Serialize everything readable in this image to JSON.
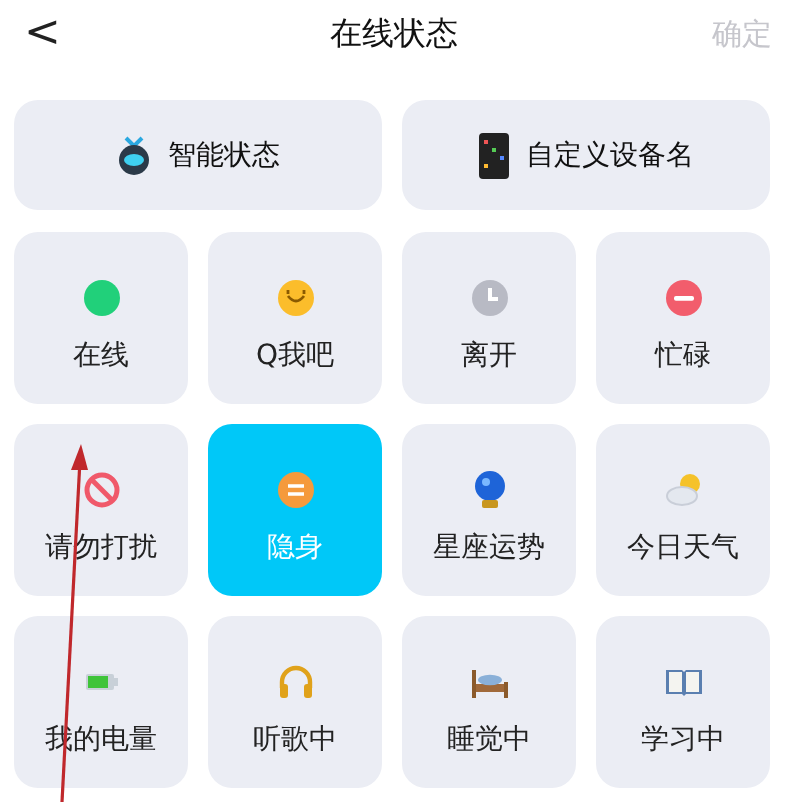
{
  "header": {
    "back": "<",
    "title": "在线状态",
    "confirm": "确定",
    "confirm_disabled": true
  },
  "quick_actions": [
    {
      "label": "智能状态"
    },
    {
      "label": "自定义设备名"
    }
  ],
  "statuses": [
    {
      "label": "在线",
      "selected": false
    },
    {
      "label": "Q我吧",
      "selected": false
    },
    {
      "label": "离开",
      "selected": false
    },
    {
      "label": "忙碌",
      "selected": false
    },
    {
      "label": "请勿打扰",
      "selected": false
    },
    {
      "label": "隐身",
      "selected": true
    },
    {
      "label": "星座运势",
      "selected": false
    },
    {
      "label": "今日天气",
      "selected": false
    },
    {
      "label": "我的电量",
      "selected": false
    },
    {
      "label": "听歌中",
      "selected": false
    },
    {
      "label": "睡觉中",
      "selected": false
    },
    {
      "label": "学习中",
      "selected": false
    }
  ],
  "annotations": [
    {
      "kind": "arrow"
    }
  ]
}
